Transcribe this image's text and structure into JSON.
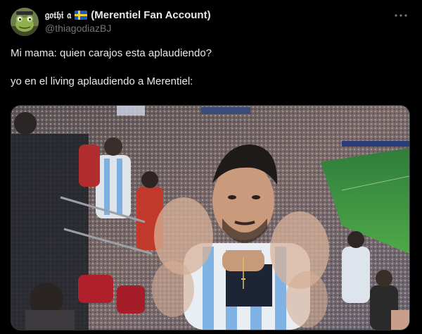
{
  "author": {
    "display_name_gothic": "𝔤𝔬𝔱𝔥𝔦 𝔞",
    "flag_icon": "sweden-flag-icon",
    "display_name_rest": "(Merentiel Fan Account)",
    "handle": "@thiagodiazBJ",
    "avatar_icon": "cartoon-frog-avatar"
  },
  "menu": {
    "icon": "more-options-icon"
  },
  "tweet": {
    "line1": "Mi mama: quien carajos esta aplaudiendo?",
    "line2": "yo en el living aplaudiendo a Merentiel:"
  },
  "media": {
    "description_icon": "stadium-photo"
  },
  "colors": {
    "background": "#000000",
    "text": "#e7e9ea",
    "secondary": "#71767b",
    "border": "#2f3336"
  }
}
